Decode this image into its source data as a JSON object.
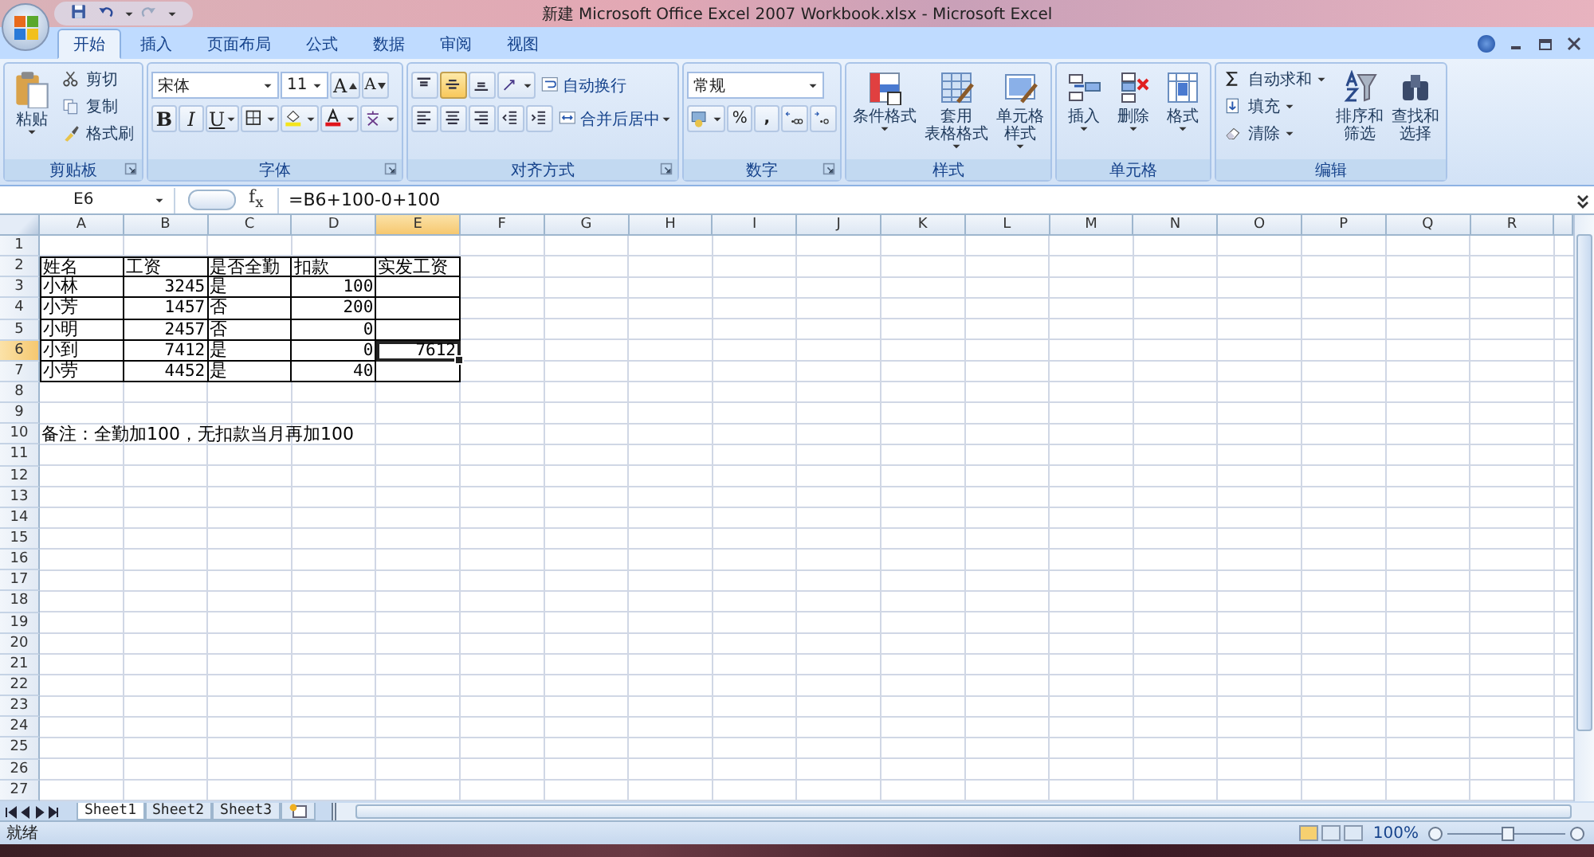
{
  "title_bar": {
    "title": "新建 Microsoft Office Excel 2007 Workbook.xlsx - Microsoft Excel"
  },
  "tabs": [
    {
      "label": "开始",
      "selected": true
    },
    {
      "label": "插入",
      "selected": false
    },
    {
      "label": "页面布局",
      "selected": false
    },
    {
      "label": "公式",
      "selected": false
    },
    {
      "label": "数据",
      "selected": false
    },
    {
      "label": "审阅",
      "selected": false
    },
    {
      "label": "视图",
      "selected": false
    }
  ],
  "ribbon": {
    "clipboard": {
      "label": "剪贴板",
      "paste": "粘贴",
      "items": [
        "剪切",
        "复制",
        "格式刷"
      ]
    },
    "font": {
      "label": "字体",
      "font_name": "宋体",
      "font_size": "11",
      "grow": "A",
      "shrink": "A",
      "bold": "B",
      "italic": "I",
      "underline": "U"
    },
    "alignment": {
      "label": "对齐方式",
      "vertical": [
        {
          "selected": false
        },
        {
          "selected": true
        },
        {
          "selected": false
        }
      ],
      "wrap": "自动换行",
      "merge": "合并后居中"
    },
    "number": {
      "label": "数字",
      "format": "常规",
      "percent": "%",
      "comma": ","
    },
    "styles": {
      "label": "样式",
      "buttons": [
        {
          "lines": [
            "条件格式"
          ]
        },
        {
          "lines": [
            "套用",
            "表格格式"
          ]
        },
        {
          "lines": [
            "单元格",
            "样式"
          ]
        }
      ]
    },
    "cells": {
      "label": "单元格",
      "buttons": [
        "插入",
        "删除",
        "格式"
      ]
    },
    "editing": {
      "label": "编辑",
      "items": [
        "自动求和",
        "填充",
        "清除"
      ],
      "buttons": [
        {
          "lines": [
            "排序和",
            "筛选"
          ]
        },
        {
          "lines": [
            "查找和",
            "选择"
          ]
        }
      ]
    }
  },
  "formula_bar": {
    "name_box": "E6",
    "function_button": "f$_{x}$",
    "formula": "=B6+100-0+100"
  },
  "columns": [
    {
      "label": "A",
      "selected": false
    },
    {
      "label": "B",
      "selected": false
    },
    {
      "label": "C",
      "selected": false
    },
    {
      "label": "D",
      "selected": false
    },
    {
      "label": "E",
      "selected": true
    },
    {
      "label": "F",
      "selected": false
    },
    {
      "label": "G",
      "selected": false
    },
    {
      "label": "H",
      "selected": false
    },
    {
      "label": "I",
      "selected": false
    },
    {
      "label": "J",
      "selected": false
    },
    {
      "label": "K",
      "selected": false
    },
    {
      "label": "L",
      "selected": false
    },
    {
      "label": "M",
      "selected": false
    },
    {
      "label": "N",
      "selected": false
    },
    {
      "label": "O",
      "selected": false
    },
    {
      "label": "P",
      "selected": false
    },
    {
      "label": "Q",
      "selected": false
    },
    {
      "label": "R",
      "selected": false
    }
  ],
  "rows": [
    {
      "header": "1",
      "selected": false,
      "bordered": false
    },
    {
      "header": "2",
      "selected": false,
      "bordered": true,
      "cells": [
        "姓名",
        "工资",
        "是否全勤",
        "扣款",
        "实发工资"
      ]
    },
    {
      "header": "3",
      "selected": false,
      "bordered": true,
      "cells": [
        "小林",
        "3245",
        "是",
        "100",
        null
      ]
    },
    {
      "header": "4",
      "selected": false,
      "bordered": true,
      "cells": [
        "小芳",
        "1457",
        "否",
        "200",
        null
      ]
    },
    {
      "header": "5",
      "selected": false,
      "bordered": true,
      "cells": [
        "小明",
        "2457",
        "否",
        "0",
        null
      ]
    },
    {
      "header": "6",
      "selected": true,
      "bordered": true,
      "cells": [
        "小到",
        "7412",
        "是",
        "0",
        "7612"
      ]
    },
    {
      "header": "7",
      "selected": false,
      "bordered": true,
      "cells": [
        "小劳",
        "4452",
        "是",
        "40",
        null
      ]
    },
    {
      "header": "8",
      "selected": false,
      "bordered": false
    },
    {
      "header": "9",
      "selected": false,
      "bordered": false
    },
    {
      "header": "10",
      "selected": false,
      "bordered": false,
      "cells": [
        "备注：全勤加100，无扣款当月再加100"
      ]
    },
    {
      "header": "11",
      "selected": false,
      "bordered": false
    },
    {
      "header": "12",
      "selected": false,
      "bordered": false
    },
    {
      "header": "13",
      "selected": false,
      "bordered": false
    },
    {
      "header": "14",
      "selected": false,
      "bordered": false
    },
    {
      "header": "15",
      "selected": false,
      "bordered": false
    },
    {
      "header": "16",
      "selected": false,
      "bordered": false
    },
    {
      "header": "17",
      "selected": false,
      "bordered": false
    },
    {
      "header": "18",
      "selected": false,
      "bordered": false
    },
    {
      "header": "19",
      "selected": false,
      "bordered": false
    },
    {
      "header": "20",
      "selected": false,
      "bordered": false
    },
    {
      "header": "21",
      "selected": false,
      "bordered": false
    },
    {
      "header": "22",
      "selected": false,
      "bordered": false
    },
    {
      "header": "23",
      "selected": false,
      "bordered": false
    },
    {
      "header": "24",
      "selected": false,
      "bordered": false
    },
    {
      "header": "25",
      "selected": false,
      "bordered": false
    },
    {
      "header": "26",
      "selected": false,
      "bordered": false
    },
    {
      "header": "27",
      "selected": false,
      "bordered": false
    }
  ],
  "sheet_tabs": [
    {
      "label": "Sheet1",
      "selected": true
    },
    {
      "label": "Sheet2",
      "selected": false
    },
    {
      "label": "Sheet3",
      "selected": false
    }
  ],
  "status_bar": {
    "status": "就绪",
    "zoom": "100%",
    "zoom_slider": {
      "level": 0.52
    }
  }
}
